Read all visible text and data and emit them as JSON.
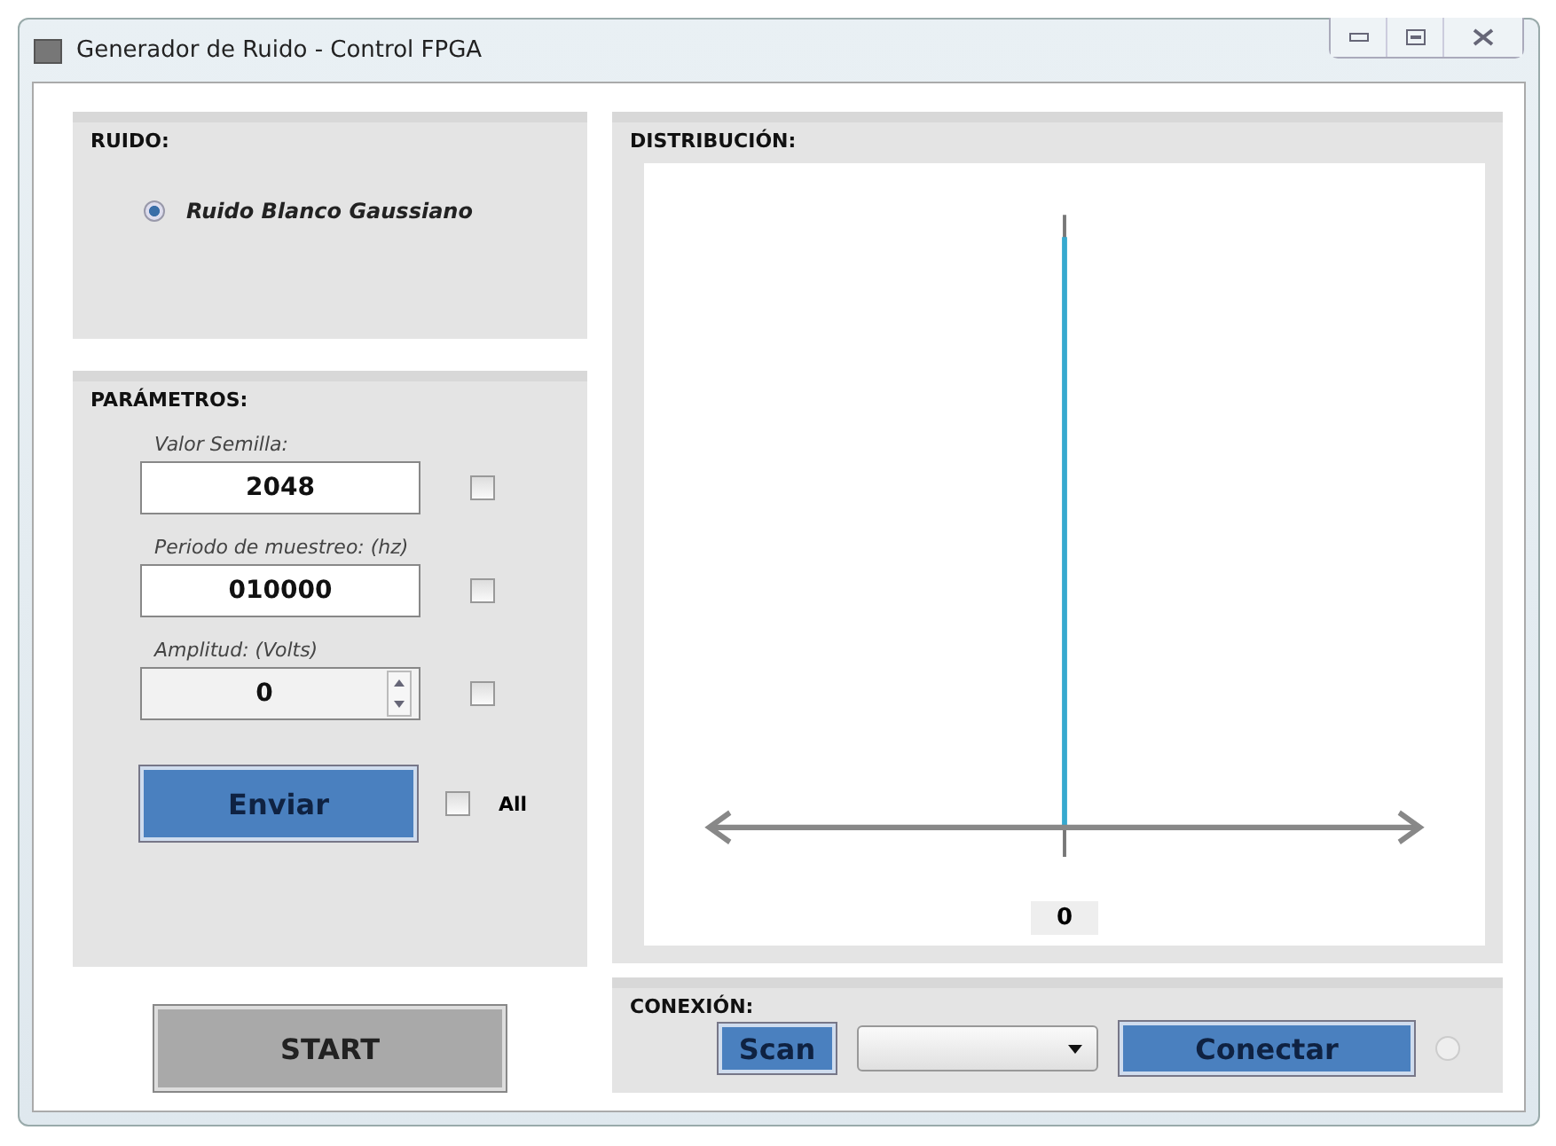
{
  "window": {
    "title": "Generador de Ruido - Control FPGA"
  },
  "noise": {
    "heading": "RUIDO:",
    "options": [
      {
        "label": "Ruido Blanco Gaussiano",
        "selected": true
      }
    ]
  },
  "parameters": {
    "heading": "PARÁMETROS:",
    "fields": [
      {
        "kind": "text",
        "label": "Valor Semilla:",
        "value": "2048",
        "checked": false
      },
      {
        "kind": "text",
        "label": "Periodo de muestreo: (hz)",
        "value": "010000",
        "checked": false
      },
      {
        "kind": "spin",
        "label": "Amplitud: (Volts)",
        "value": "0",
        "checked": false
      }
    ],
    "send_button": "Enviar",
    "all": {
      "label": "All",
      "checked": false
    }
  },
  "start_button": "START",
  "distribution": {
    "heading": "DISTRIBUCIÓN:",
    "axis_label": "0"
  },
  "connection": {
    "heading": "CONEXIÓN:",
    "scan_button": "Scan",
    "connect_button": "Conectar",
    "connected": false
  }
}
